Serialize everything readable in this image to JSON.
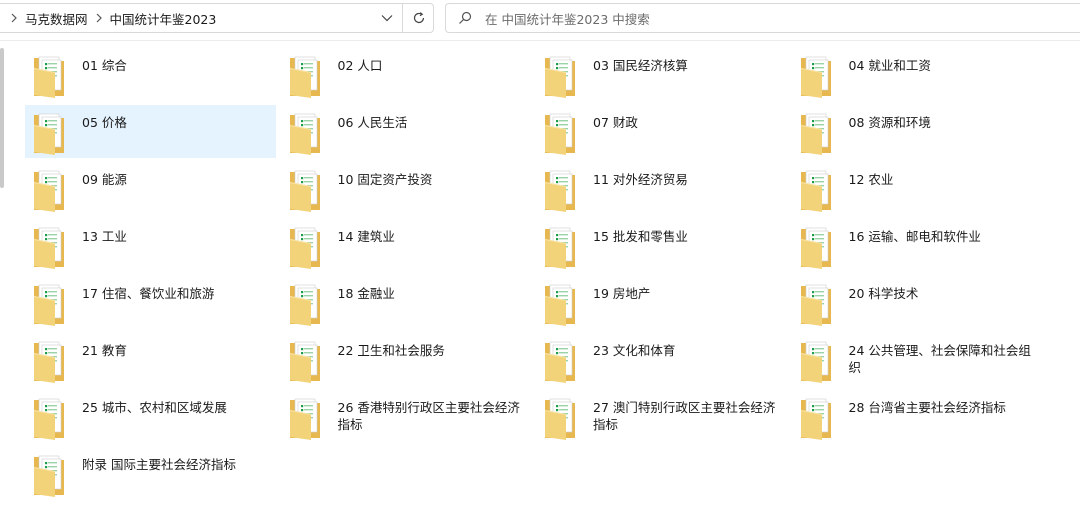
{
  "address_bar": {
    "breadcrumbs": [
      "马克数据网",
      "中国统计年鉴2023"
    ]
  },
  "search": {
    "placeholder": "在 中国统计年鉴2023 中搜索"
  },
  "folders": [
    {
      "name": "01 综合"
    },
    {
      "name": "02 人口"
    },
    {
      "name": "03 国民经济核算"
    },
    {
      "name": "04 就业和工资"
    },
    {
      "name": "05 价格",
      "selected": true
    },
    {
      "name": "06 人民生活"
    },
    {
      "name": "07 财政"
    },
    {
      "name": "08 资源和环境"
    },
    {
      "name": "09 能源"
    },
    {
      "name": "10 固定资产投资"
    },
    {
      "name": "11 对外经济贸易"
    },
    {
      "name": "12 农业"
    },
    {
      "name": "13 工业"
    },
    {
      "name": "14 建筑业"
    },
    {
      "name": "15 批发和零售业"
    },
    {
      "name": "16 运输、邮电和软件业"
    },
    {
      "name": "17 住宿、餐饮业和旅游"
    },
    {
      "name": "18 金融业"
    },
    {
      "name": "19 房地产"
    },
    {
      "name": "20 科学技术"
    },
    {
      "name": "21 教育"
    },
    {
      "name": "22 卫生和社会服务"
    },
    {
      "name": "23 文化和体育"
    },
    {
      "name": "24 公共管理、社会保障和社会组织"
    },
    {
      "name": "25 城市、农村和区域发展"
    },
    {
      "name": "26 香港特别行政区主要社会经济指标"
    },
    {
      "name": "27 澳门特别行政区主要社会经济指标"
    },
    {
      "name": "28 台湾省主要社会经济指标"
    },
    {
      "name": "附录 国际主要社会经济指标"
    }
  ],
  "icons": {
    "breadcrumb_separator": "chevron-right-icon",
    "address_dropdown": "chevron-down-icon",
    "refresh": "refresh-icon",
    "search": "search-icon",
    "folder": "folder-icon"
  },
  "colors": {
    "selection": "#e5f3ff",
    "folder": "#f3d37a",
    "file_accent": "#1e9e4a"
  }
}
